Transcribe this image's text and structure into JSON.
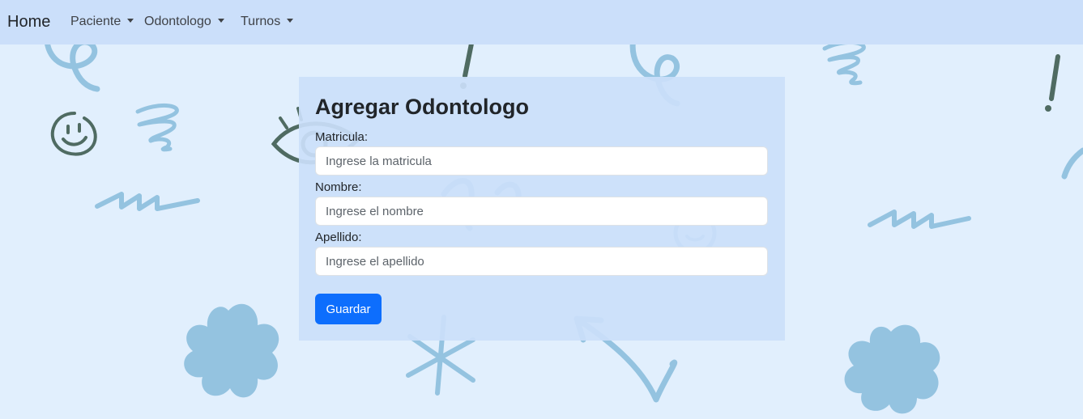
{
  "navbar": {
    "brand": "Home",
    "items": [
      {
        "label": "Paciente"
      },
      {
        "label": "Odontologo"
      },
      {
        "label": "Turnos"
      }
    ]
  },
  "form": {
    "title": "Agregar Odontologo",
    "fields": [
      {
        "label": "Matricula:",
        "placeholder": "Ingrese la matricula",
        "value": ""
      },
      {
        "label": "Nombre:",
        "placeholder": "Ingrese el nombre",
        "value": ""
      },
      {
        "label": "Apellido:",
        "placeholder": "Ingrese el apellido",
        "value": ""
      }
    ],
    "submit_label": "Guardar"
  },
  "colors": {
    "page_background": "#e1effd",
    "navbar_background": "#cbdffa",
    "card_background": "#cbdffa",
    "primary_button": "#0d6efd",
    "doodle_light": "#94c3e0",
    "doodle_dark": "#4f6b62"
  },
  "icons": {
    "dropdown": "caret-down-icon",
    "background": [
      "swirl-doodle-icon",
      "smiley-face-icon",
      "eye-doodle-icon",
      "exclamation-icon",
      "zigzag-doodle-icon",
      "flower-doodle-icon",
      "asterisk-star-icon",
      "arrow-doodle-icon"
    ]
  }
}
